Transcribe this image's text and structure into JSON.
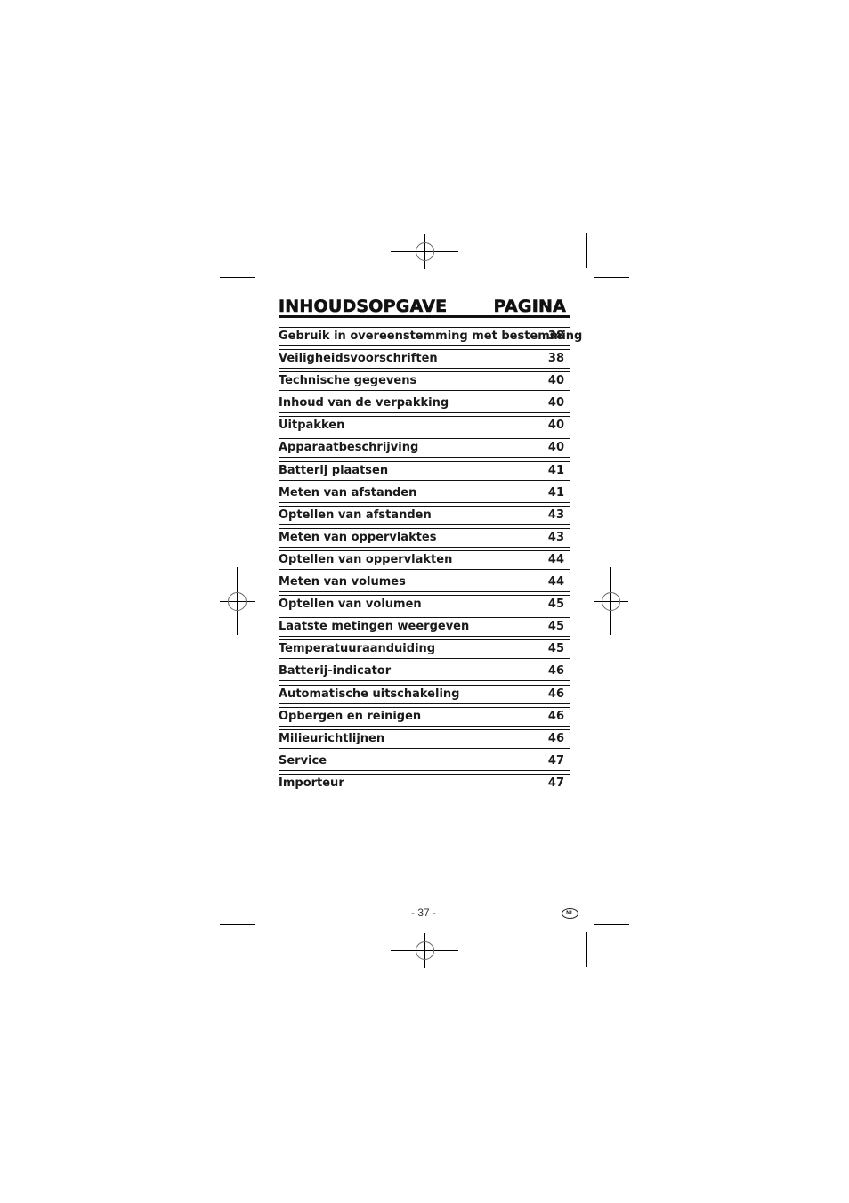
{
  "heading": {
    "title": "INHOUDSOPGAVE",
    "page_label": "PAGINA"
  },
  "toc": [
    {
      "title": "Gebruik in overeenstemming met bestemming",
      "page": "38"
    },
    {
      "title": "Veiligheidsvoorschriften",
      "page": "38"
    },
    {
      "title": "Technische gegevens",
      "page": "40"
    },
    {
      "title": "Inhoud van de verpakking",
      "page": "40"
    },
    {
      "title": "Uitpakken",
      "page": "40"
    },
    {
      "title": "Apparaatbeschrijving",
      "page": "40"
    },
    {
      "title": "Batterij plaatsen",
      "page": "41"
    },
    {
      "title": "Meten van afstanden",
      "page": "41"
    },
    {
      "title": "Optellen van afstanden",
      "page": "43"
    },
    {
      "title": "Meten van oppervlaktes",
      "page": "43"
    },
    {
      "title": "Optellen van oppervlakten",
      "page": "44"
    },
    {
      "title": "Meten van volumes",
      "page": "44"
    },
    {
      "title": "Optellen van volumen",
      "page": "45"
    },
    {
      "title": "Laatste metingen weergeven",
      "page": "45"
    },
    {
      "title": "Temperatuuraanduiding",
      "page": "45"
    },
    {
      "title": "Batterij-indicator",
      "page": "46"
    },
    {
      "title": "Automatische uitschakeling",
      "page": "46"
    },
    {
      "title": "Opbergen en reinigen",
      "page": "46"
    },
    {
      "title": "Milieurichtlijnen",
      "page": "46"
    },
    {
      "title": "Service",
      "page": "47"
    },
    {
      "title": "Importeur",
      "page": "47"
    }
  ],
  "footer": {
    "page_number": "- 37 -",
    "language_badge": "NL"
  }
}
